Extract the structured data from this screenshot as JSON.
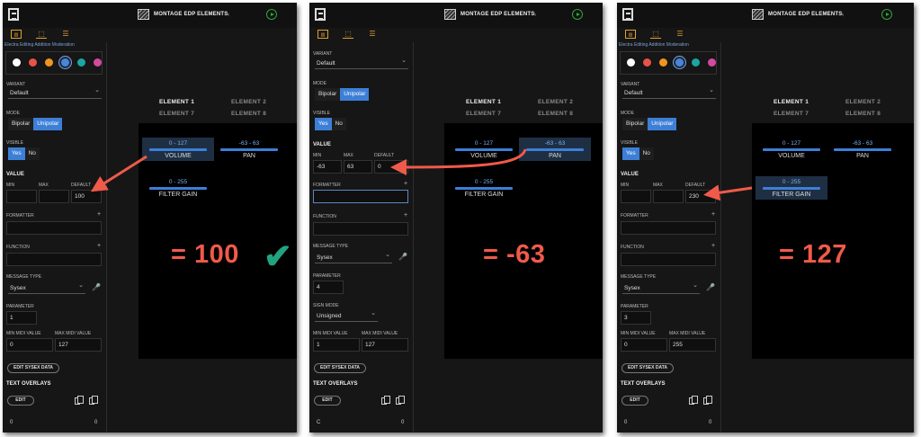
{
  "app": {
    "title": "MONTAGE EDP ELEMENTS",
    "cut_tabs": "Electra   Editing   Addition   Moderation",
    "colors": [
      "#ffffff",
      "#e8524a",
      "#f0961e",
      "#4a86d8",
      "#1aa7a0",
      "#d24aa0"
    ],
    "variant_label": "VARIANT",
    "variant_value": "Default",
    "mode_label": "MODE",
    "mode_bipolar": "Bipolar",
    "mode_unipolar": "Unipolar",
    "visible_label": "VISIBLE",
    "visible_yes": "Yes",
    "visible_no": "No",
    "value_label": "VALUE",
    "min_label": "MIN",
    "max_label": "MAX",
    "default_label": "DEFAULT",
    "formatter_label": "FORMATTER",
    "function_label": "FUNCTION",
    "plus": "+",
    "message_type_label": "MESSAGE TYPE",
    "message_type_value": "Sysex",
    "parameter_label": "PARAMETER",
    "sign_mode_label": "SIGN MODE",
    "sign_mode_value": "Unsigned",
    "min_midi_label": "MIN MIDI VALUE",
    "max_midi_label": "MAX MIDI VALUE",
    "edit_sysex": "EDIT SYSEX DATA",
    "text_overlays": "TEXT OVERLAYS",
    "edit": "EDIT",
    "tabs": [
      "ELEMENT 1",
      "ELEMENT 2",
      "ELEMENT 7",
      "ELEMENT 8"
    ],
    "controls": [
      {
        "range": "0 - 127",
        "name": "VOLUME"
      },
      {
        "range": "-63 - 63",
        "name": "PAN"
      },
      {
        "range": "0 - 255",
        "name": "FILTER GAIN"
      }
    ]
  },
  "panels": [
    {
      "min": "",
      "max": "",
      "default": "100",
      "parameter": "1",
      "min_midi": "0",
      "max_midi": "127",
      "foot_left": "0",
      "foot_right": "0",
      "result": "= 100"
    },
    {
      "min": "-63",
      "max": "63",
      "default": "0",
      "parameter": "4",
      "min_midi": "1",
      "max_midi": "127",
      "foot_left": "C",
      "foot_right": "0",
      "result": "= -63"
    },
    {
      "min": "",
      "max": "",
      "default": "230",
      "parameter": "3",
      "min_midi": "0",
      "max_midi": "255",
      "foot_left": "0",
      "foot_right": "0",
      "result": "= 127"
    }
  ]
}
